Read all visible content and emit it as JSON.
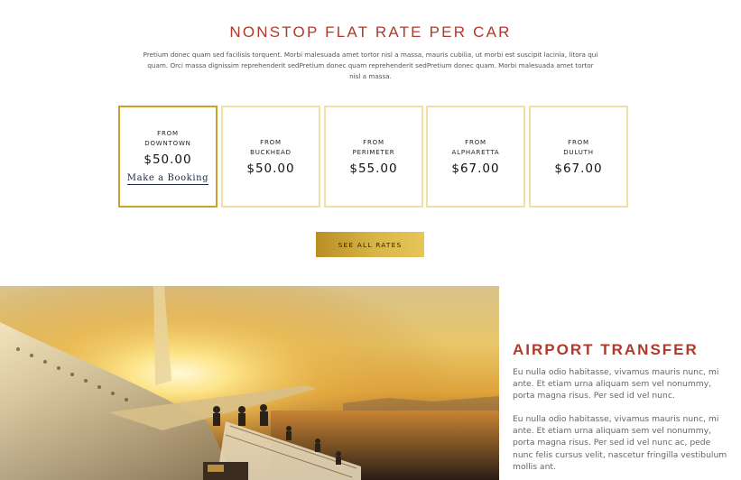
{
  "rates": {
    "title": "NONSTOP FLAT RATE PER CAR",
    "intro": "Pretium donec quam sed facilisis torquent. Morbi malesuada amet tortor nisl a massa, mauris cubilia, ut morbi est suscipit lacinia, litora qui quam. Orci massa dignissim reprehenderit sedPretium donec quam reprehenderit sedPretium donec quam. Morbi malesuada amet tortor nisl a massa.",
    "cards": [
      {
        "from": "FROM",
        "place": "DOWNTOWN",
        "price": "$50.00",
        "booking": "Make a Booking"
      },
      {
        "from": "FROM",
        "place": "BUCKHEAD",
        "price": "$50.00"
      },
      {
        "from": "FROM",
        "place": "PERIMETER",
        "price": "$55.00"
      },
      {
        "from": "FROM",
        "place": "ALPHARETTA",
        "price": "$67.00"
      },
      {
        "from": "FROM",
        "place": "DULUTH",
        "price": "$67.00"
      }
    ],
    "see_all_label": "SEE ALL RATES"
  },
  "airport": {
    "title": "AIRPORT TRANSFER",
    "paragraphs": [
      "Eu nulla odio habitasse, vivamus mauris nunc, mi ante. Et etiam urna aliquam sem vel nonummy, porta magna risus. Per sed id vel nunc.",
      "Eu nulla odio habitasse, vivamus mauris nunc, mi ante. Et etiam urna aliquam sem vel nonummy, porta magna risus. Per sed id vel nunc ac, pede nunc felis cursus velit, nascetur fringilla vestibulum mollis ant."
    ]
  },
  "colors": {
    "accent_red": "#b0392a",
    "gold": "#c9a227",
    "card_border": "#f1dfa6"
  }
}
